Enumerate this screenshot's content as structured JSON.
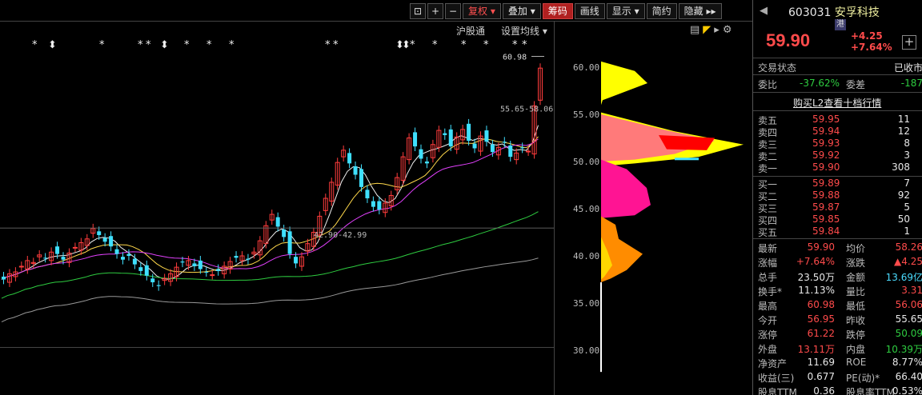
{
  "toolbar": {
    "fuquan": "复权",
    "diejia": "叠加",
    "chouma": "筹码",
    "huaxian": "画线",
    "xianshi": "显示",
    "jianyue": "简约",
    "yincang": "隐藏"
  },
  "links": {
    "hugutong": "沪股通",
    "junxian": "设置均线"
  },
  "chart_data": {
    "type": "candlestick",
    "price_axis": [
      "60.00",
      "55.00",
      "50.00",
      "45.00",
      "40.00",
      "35.00",
      "30.00"
    ],
    "annotations": {
      "high": "60.98",
      "range": "55.65-58.06",
      "level": "42.90-42.99"
    },
    "ylim": [
      28,
      64
    ]
  },
  "stock": {
    "code": "603031",
    "name": "安孚科技",
    "tag": "港",
    "price": "59.90",
    "change": "+4.25",
    "pct": "+7.64%"
  },
  "status": {
    "label": "交易状态",
    "value": "已收市"
  },
  "webi": {
    "label": "委比",
    "value": "-37.62%",
    "label2": "委差",
    "value2": "-187"
  },
  "l2_link": "购买L2查看十档行情",
  "asks": [
    {
      "label": "卖五",
      "price": "59.95",
      "vol": "11"
    },
    {
      "label": "卖四",
      "price": "59.94",
      "vol": "12"
    },
    {
      "label": "卖三",
      "price": "59.93",
      "vol": "8"
    },
    {
      "label": "卖二",
      "price": "59.92",
      "vol": "3"
    },
    {
      "label": "卖一",
      "price": "59.90",
      "vol": "308"
    }
  ],
  "bids": [
    {
      "label": "买一",
      "price": "59.89",
      "vol": "7"
    },
    {
      "label": "买二",
      "price": "59.88",
      "vol": "92"
    },
    {
      "label": "买三",
      "price": "59.87",
      "vol": "5"
    },
    {
      "label": "买四",
      "price": "59.85",
      "vol": "50"
    },
    {
      "label": "买五",
      "price": "59.84",
      "vol": "1"
    }
  ],
  "stats": [
    {
      "l1": "最新",
      "v1": "59.90",
      "c1": "red",
      "l2": "均价",
      "v2": "58.26",
      "c2": "red"
    },
    {
      "l1": "涨幅",
      "v1": "+7.64%",
      "c1": "red",
      "l2": "涨跌",
      "v2": "▲4.25",
      "c2": "red"
    },
    {
      "l1": "总手",
      "v1": "23.50万",
      "c1": "white",
      "l2": "金额",
      "v2": "13.69亿",
      "c2": "cyan"
    },
    {
      "l1": "换手*",
      "v1": "11.13%",
      "c1": "white",
      "l2": "量比",
      "v2": "3.31",
      "c2": "red"
    },
    {
      "l1": "最高",
      "v1": "60.98",
      "c1": "red",
      "l2": "最低",
      "v2": "56.06",
      "c2": "red"
    },
    {
      "l1": "今开",
      "v1": "56.95",
      "c1": "red",
      "l2": "昨收",
      "v2": "55.65",
      "c2": "white"
    },
    {
      "l1": "涨停",
      "v1": "61.22",
      "c1": "red",
      "l2": "跌停",
      "v2": "50.09",
      "c2": "green"
    },
    {
      "l1": "外盘",
      "v1": "13.11万",
      "c1": "red",
      "l2": "内盘",
      "v2": "10.39万",
      "c2": "green"
    },
    {
      "l1": "净资产",
      "v1": "11.69",
      "c1": "white",
      "l2": "ROE",
      "v2": "8.77%",
      "c2": "white"
    },
    {
      "l1": "收益(三)",
      "v1": "0.677",
      "c1": "white",
      "l2": "PE(动)*",
      "v2": "66.40",
      "c2": "white"
    },
    {
      "l1": "股息TTM",
      "v1": "0.36",
      "c1": "white",
      "l2": "股息率TTM",
      "v2": "0.53%",
      "c2": "white"
    }
  ]
}
